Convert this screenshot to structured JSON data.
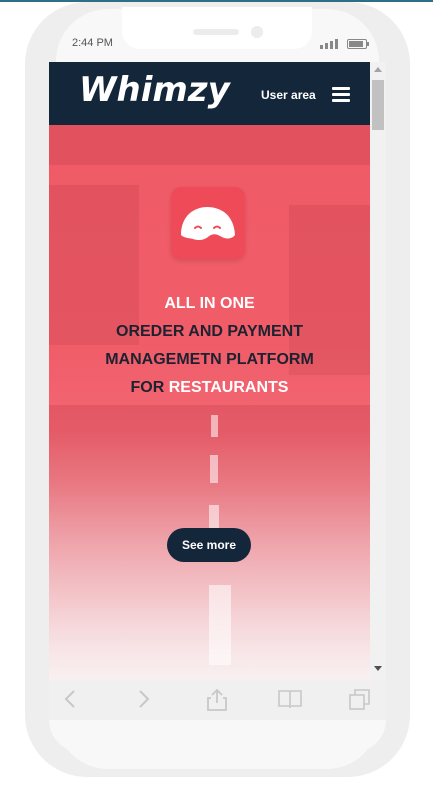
{
  "status_bar": {
    "time": "2:44 PM"
  },
  "navbar": {
    "logo": "Whimzy",
    "user_area": "User area"
  },
  "hero": {
    "headline": {
      "line1": "ALL IN ONE",
      "line2": "OREDER AND PAYMENT",
      "line3": "MANAGEMETN PLATFORM",
      "line4_prefix": "FOR ",
      "line4_highlight": "RESTAURANTS"
    },
    "cta_label": "See more"
  },
  "colors": {
    "navbar": "#13263a",
    "hero_overlay": "#ef5a66",
    "app_icon": "#ef4a57",
    "headline_dark": "#1c2230",
    "headline_light": "#ffffff"
  },
  "icons": [
    "whimzy-mask-icon",
    "hamburger-menu-icon",
    "back-icon",
    "forward-icon",
    "share-icon",
    "bookmarks-icon",
    "tabs-icon"
  ]
}
